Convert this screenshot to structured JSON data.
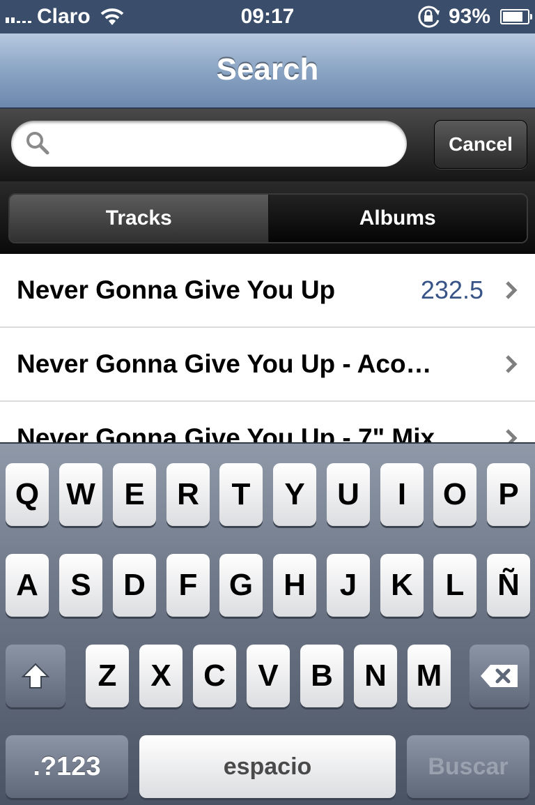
{
  "status_bar": {
    "carrier": "Claro",
    "time": "09:17",
    "battery_percent": "93%",
    "battery_level": 0.93,
    "icons": [
      "signal-bars-icon",
      "wifi-icon",
      "rotation-lock-icon",
      "battery-icon"
    ]
  },
  "nav": {
    "title": "Search"
  },
  "search": {
    "value": "",
    "placeholder": "",
    "cancel_label": "Cancel"
  },
  "segments": {
    "tracks_label": "Tracks",
    "albums_label": "Albums",
    "selected": "Tracks"
  },
  "results": [
    {
      "title": "Never Gonna Give You Up",
      "value": "232.5"
    },
    {
      "title": "Never Gonna Give You Up - Aco…",
      "value": ""
    },
    {
      "title": "Never Gonna Give You Up - 7\" Mix",
      "value": ""
    }
  ],
  "keyboard": {
    "row1": [
      "Q",
      "W",
      "E",
      "R",
      "T",
      "Y",
      "U",
      "I",
      "O",
      "P"
    ],
    "row2": [
      "A",
      "S",
      "D",
      "F",
      "G",
      "H",
      "J",
      "K",
      "L",
      "Ñ"
    ],
    "row3": [
      "Z",
      "X",
      "C",
      "V",
      "B",
      "N",
      "M"
    ],
    "numbers_label": ".?123",
    "space_label": "espacio",
    "search_label": "Buscar",
    "icons": [
      "shift-icon",
      "backspace-icon"
    ]
  },
  "colors": {
    "nav_gradient_top": "#b7c9df",
    "nav_gradient_bottom": "#6d88ad",
    "value_text": "#385487",
    "search_key_text": "#9aa2b0"
  }
}
